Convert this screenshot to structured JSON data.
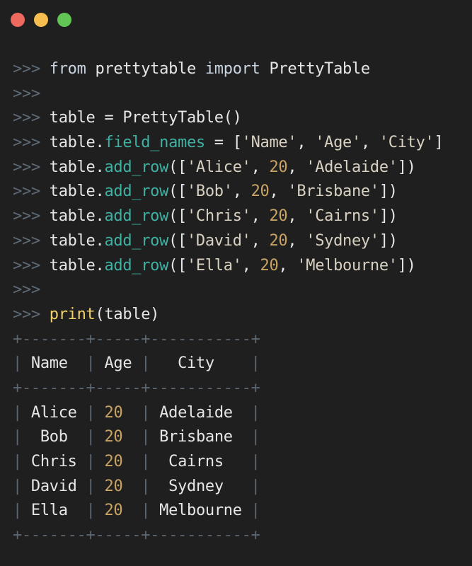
{
  "window": {
    "colors": {
      "close": "#ee6a5f",
      "minimize": "#f5be4f",
      "maximize": "#62c655",
      "background": "#1f1f1f"
    }
  },
  "repl": {
    "prompt": ">>>",
    "lines": [
      [
        {
          "t": "prompt",
          "v": ">>> "
        },
        {
          "t": "kw",
          "v": "from "
        },
        {
          "t": "ident",
          "v": "prettytable "
        },
        {
          "t": "kw",
          "v": "import "
        },
        {
          "t": "ident",
          "v": "PrettyTable"
        }
      ],
      [
        {
          "t": "prompt",
          "v": ">>>"
        }
      ],
      [
        {
          "t": "prompt",
          "v": ">>> "
        },
        {
          "t": "ident",
          "v": "table = PrettyTable()"
        }
      ],
      [
        {
          "t": "prompt",
          "v": ">>> "
        },
        {
          "t": "ident",
          "v": "table."
        },
        {
          "t": "attr",
          "v": "field_names"
        },
        {
          "t": "punct",
          "v": " = ["
        },
        {
          "t": "str",
          "v": "'Name'"
        },
        {
          "t": "punct",
          "v": ", "
        },
        {
          "t": "str",
          "v": "'Age'"
        },
        {
          "t": "punct",
          "v": ", "
        },
        {
          "t": "str",
          "v": "'City'"
        },
        {
          "t": "punct",
          "v": "]"
        }
      ],
      [
        {
          "t": "prompt",
          "v": ">>> "
        },
        {
          "t": "ident",
          "v": "table."
        },
        {
          "t": "attr",
          "v": "add_row"
        },
        {
          "t": "punct",
          "v": "(["
        },
        {
          "t": "str",
          "v": "'Alice'"
        },
        {
          "t": "punct",
          "v": ", "
        },
        {
          "t": "num",
          "v": "20"
        },
        {
          "t": "punct",
          "v": ", "
        },
        {
          "t": "str",
          "v": "'Adelaide'"
        },
        {
          "t": "punct",
          "v": "])"
        }
      ],
      [
        {
          "t": "prompt",
          "v": ">>> "
        },
        {
          "t": "ident",
          "v": "table."
        },
        {
          "t": "attr",
          "v": "add_row"
        },
        {
          "t": "punct",
          "v": "(["
        },
        {
          "t": "str",
          "v": "'Bob'"
        },
        {
          "t": "punct",
          "v": ", "
        },
        {
          "t": "num",
          "v": "20"
        },
        {
          "t": "punct",
          "v": ", "
        },
        {
          "t": "str",
          "v": "'Brisbane'"
        },
        {
          "t": "punct",
          "v": "])"
        }
      ],
      [
        {
          "t": "prompt",
          "v": ">>> "
        },
        {
          "t": "ident",
          "v": "table."
        },
        {
          "t": "attr",
          "v": "add_row"
        },
        {
          "t": "punct",
          "v": "(["
        },
        {
          "t": "str",
          "v": "'Chris'"
        },
        {
          "t": "punct",
          "v": ", "
        },
        {
          "t": "num",
          "v": "20"
        },
        {
          "t": "punct",
          "v": ", "
        },
        {
          "t": "str",
          "v": "'Cairns'"
        },
        {
          "t": "punct",
          "v": "])"
        }
      ],
      [
        {
          "t": "prompt",
          "v": ">>> "
        },
        {
          "t": "ident",
          "v": "table."
        },
        {
          "t": "attr",
          "v": "add_row"
        },
        {
          "t": "punct",
          "v": "(["
        },
        {
          "t": "str",
          "v": "'David'"
        },
        {
          "t": "punct",
          "v": ", "
        },
        {
          "t": "num",
          "v": "20"
        },
        {
          "t": "punct",
          "v": ", "
        },
        {
          "t": "str",
          "v": "'Sydney'"
        },
        {
          "t": "punct",
          "v": "])"
        }
      ],
      [
        {
          "t": "prompt",
          "v": ">>> "
        },
        {
          "t": "ident",
          "v": "table."
        },
        {
          "t": "attr",
          "v": "add_row"
        },
        {
          "t": "punct",
          "v": "(["
        },
        {
          "t": "str",
          "v": "'Ella'"
        },
        {
          "t": "punct",
          "v": ", "
        },
        {
          "t": "num",
          "v": "20"
        },
        {
          "t": "punct",
          "v": ", "
        },
        {
          "t": "str",
          "v": "'Melbourne'"
        },
        {
          "t": "punct",
          "v": "])"
        }
      ],
      [
        {
          "t": "prompt",
          "v": ">>>"
        }
      ],
      [
        {
          "t": "prompt",
          "v": ">>> "
        },
        {
          "t": "fn",
          "v": "print"
        },
        {
          "t": "punct",
          "v": "(table)"
        }
      ]
    ]
  },
  "output": {
    "border_line": "+-------+-----+-----------+",
    "header": [
      "Name",
      "Age",
      "City"
    ],
    "rows": [
      [
        "Alice",
        "20",
        "Adelaide"
      ],
      [
        "Bob",
        "20",
        "Brisbane"
      ],
      [
        "Chris",
        "20",
        "Cairns"
      ],
      [
        "David",
        "20",
        "Sydney"
      ],
      [
        "Ella",
        "20",
        "Melbourne"
      ]
    ]
  }
}
